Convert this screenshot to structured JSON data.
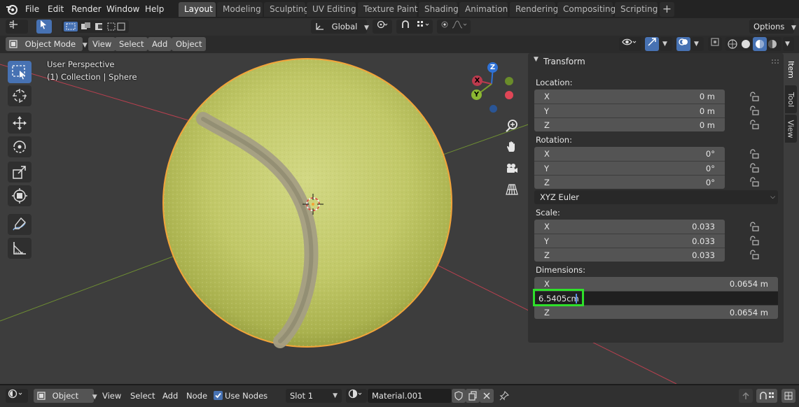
{
  "menubar": {
    "items": [
      "File",
      "Edit",
      "Render",
      "Window",
      "Help"
    ],
    "workspaces": [
      "Layout",
      "Modeling",
      "Sculpting",
      "UV Editing",
      "Texture Paint",
      "Shading",
      "Animation",
      "Rendering",
      "Compositing",
      "Scripting"
    ],
    "active_workspace": "Layout",
    "add_symbol": "+"
  },
  "tool_header": {
    "orientation": "Global",
    "options_label": "Options"
  },
  "viewport_header": {
    "mode": "Object Mode",
    "menus": [
      "View",
      "Select",
      "Add",
      "Object"
    ]
  },
  "viewport": {
    "perspective_label": "User Perspective",
    "collection_label": "(1) Collection | Sphere",
    "gizmo_labels": {
      "x": "X",
      "y": "Y",
      "z": "Z"
    },
    "colors": {
      "x_axis": "#bc3a4d",
      "y_axis": "#7a9d2e",
      "z_axis": "#2f72d6",
      "selection": "#f5a235"
    }
  },
  "npanel": {
    "section": "Transform",
    "tabs": [
      "Item",
      "Tool",
      "View"
    ],
    "active_tab": "Item",
    "location": {
      "label": "Location:",
      "x": "0 m",
      "y": "0 m",
      "z": "0 m"
    },
    "rotation": {
      "label": "Rotation:",
      "x": "0°",
      "y": "0°",
      "z": "0°"
    },
    "rotation_mode": "XYZ Euler",
    "scale": {
      "label": "Scale:",
      "x": "0.033",
      "y": "0.033",
      "z": "0.033"
    },
    "dimensions": {
      "label": "Dimensions:",
      "x": "0.0654 m",
      "y_editing": "6.5405cm",
      "z": "0.0654 m"
    },
    "axis_letters": {
      "x": "X",
      "y": "Y",
      "z": "Z"
    }
  },
  "bottom_bar": {
    "editor": "Object",
    "menus": [
      "View",
      "Select",
      "Add",
      "Node"
    ],
    "use_nodes_label": "Use Nodes",
    "use_nodes_checked": true,
    "slot": "Slot 1",
    "material": "Material.001"
  }
}
